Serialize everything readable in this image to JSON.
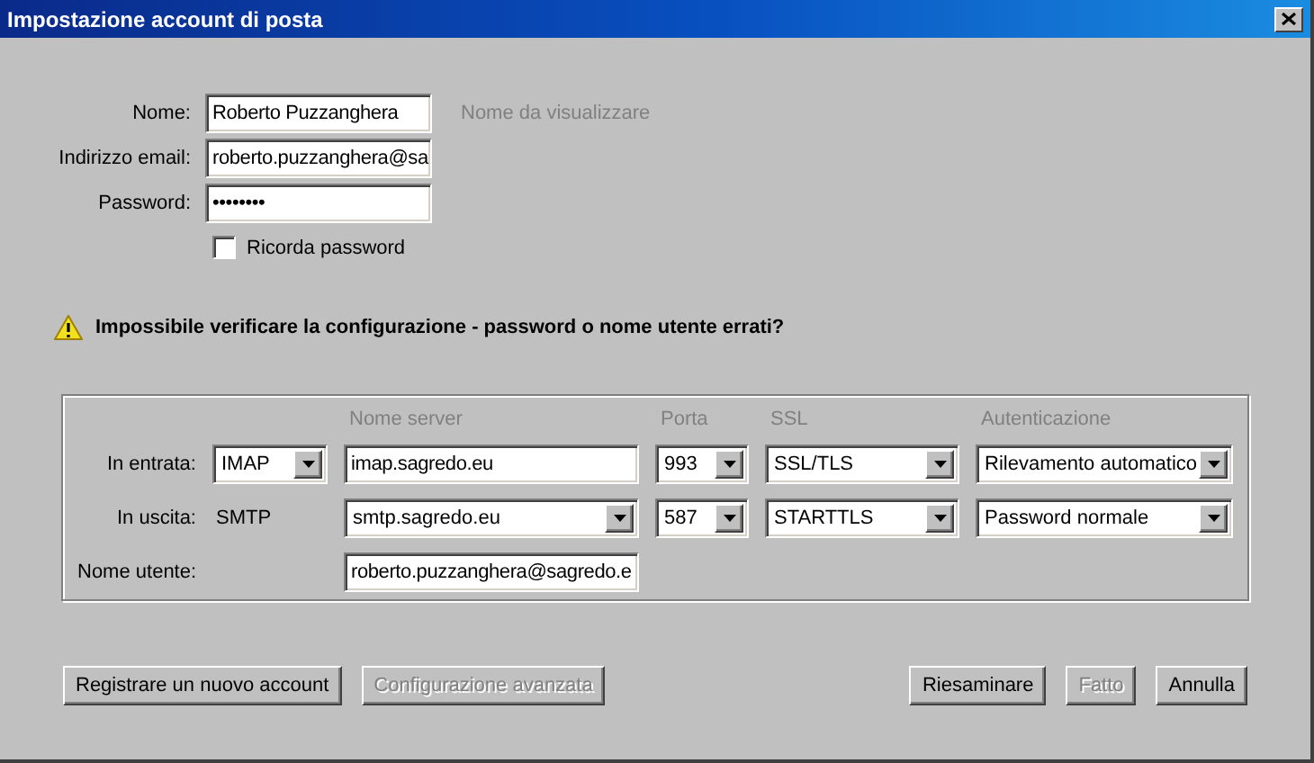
{
  "window": {
    "title": "Impostazione account di posta"
  },
  "identity": {
    "fields": [
      {
        "label": "Nome:",
        "value": "Roberto Puzzanghera",
        "note": "Nome da visualizzare"
      },
      {
        "label": "Indirizzo email:",
        "value": "roberto.puzzanghera@sa"
      },
      {
        "label": "Password:",
        "value": "••••••••"
      }
    ],
    "remember": {
      "label": "Ricorda password",
      "checked": false
    }
  },
  "warning": "Impossibile verificare la configurazione - password o nome utente errati?",
  "server": {
    "columns": [
      "",
      "Nome server",
      "Porta",
      "SSL",
      "Autenticazione"
    ],
    "rows": [
      {
        "label": "In entrata:",
        "cells": [
          {
            "kind": "combo",
            "text": "IMAP"
          },
          {
            "kind": "field",
            "text": "imap.sagredo.eu"
          },
          {
            "kind": "combo",
            "text": "993"
          },
          {
            "kind": "combo",
            "text": "SSL/TLS"
          },
          {
            "kind": "combo",
            "text": "Rilevamento automatico"
          }
        ]
      },
      {
        "label": "In uscita:",
        "cells": [
          {
            "kind": "text",
            "text": "SMTP"
          },
          {
            "kind": "combo",
            "text": "smtp.sagredo.eu"
          },
          {
            "kind": "combo",
            "text": "587"
          },
          {
            "kind": "combo",
            "text": "STARTTLS"
          },
          {
            "kind": "combo",
            "text": "Password normale"
          }
        ]
      }
    ],
    "username": {
      "label": "Nome utente:",
      "value": "roberto.puzzanghera@sagredo.e"
    }
  },
  "left_buttons": [
    {
      "label": "Registrare un nuovo account",
      "disabled": false
    },
    {
      "label": "Configurazione avanzata",
      "disabled": true
    }
  ],
  "right_buttons": [
    {
      "label": "Riesaminare",
      "disabled": false
    },
    {
      "label": "Fatto",
      "disabled": true
    },
    {
      "label": "Annulla",
      "disabled": false
    }
  ]
}
